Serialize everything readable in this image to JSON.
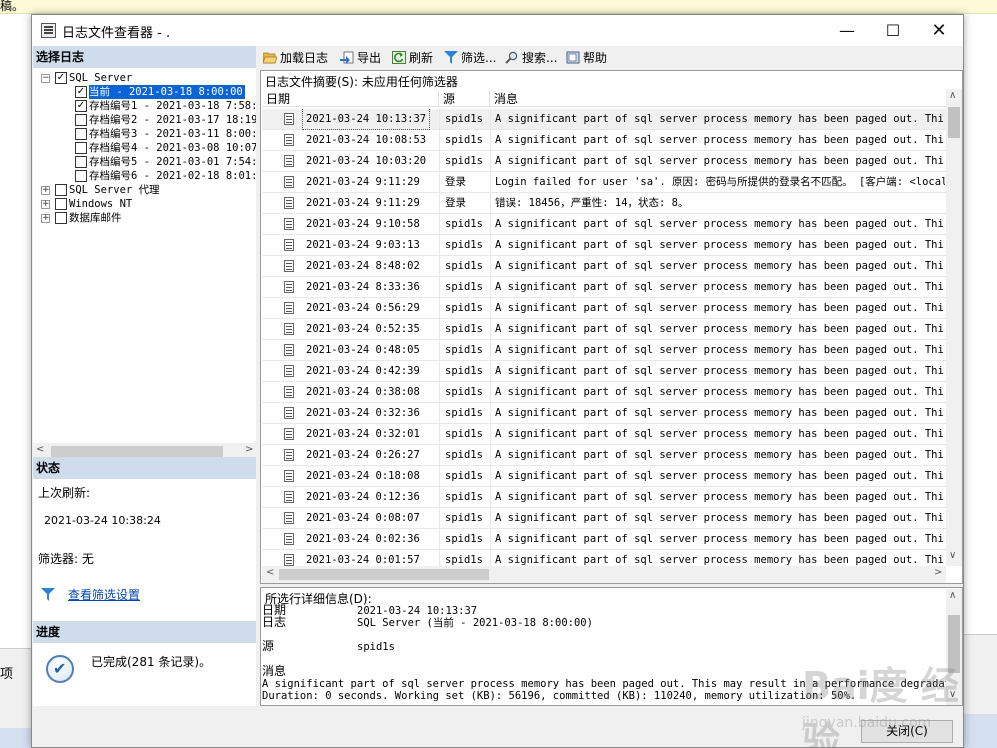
{
  "background": {
    "top_text": "稿。",
    "left_text": "项"
  },
  "window": {
    "title": "日志文件查看器 - .",
    "minimize": "—",
    "maximize": "☐",
    "close": "✕"
  },
  "left": {
    "select_log_header": "选择日志",
    "tree": [
      {
        "label": "SQL Server",
        "checked": true,
        "expander": "−",
        "indent": 0
      },
      {
        "label": "当前 - 2021-03-18 8:00:00",
        "checked": true,
        "selected": true,
        "indent": 1
      },
      {
        "label": "存档编号1 - 2021-03-18 7:58:",
        "checked": true,
        "indent": 1
      },
      {
        "label": "存档编号2 - 2021-03-17 18:19",
        "checked": false,
        "indent": 1
      },
      {
        "label": "存档编号3 - 2021-03-11 8:00:",
        "checked": false,
        "indent": 1
      },
      {
        "label": "存档编号4 - 2021-03-08 10:07",
        "checked": false,
        "indent": 1
      },
      {
        "label": "存档编号5 - 2021-03-01 7:54:",
        "checked": false,
        "indent": 1
      },
      {
        "label": "存档编号6 - 2021-02-18 8:01:",
        "checked": false,
        "indent": 1
      },
      {
        "label": "SQL Server 代理",
        "checked": false,
        "expander": "+",
        "indent": 0
      },
      {
        "label": "Windows NT",
        "checked": false,
        "expander": "+",
        "indent": 0
      },
      {
        "label": "数据库邮件",
        "checked": false,
        "expander": "+",
        "indent": 0
      }
    ],
    "status_header": "状态",
    "last_refresh_label": "上次刷新:",
    "last_refresh_value": "2021-03-24 10:38:24",
    "filter_label": "筛选器: 无",
    "view_filter_link": "查看筛选设置",
    "progress_header": "进度",
    "progress_text": "已完成(281 条记录)。"
  },
  "toolbar": {
    "load_log": "加载日志",
    "export": "导出",
    "refresh": "刷新",
    "filter": "筛选...",
    "search": "搜索...",
    "help": "帮助"
  },
  "log": {
    "summary": "日志文件摘要(S): 未应用任何筛选器",
    "columns": {
      "date": "日期",
      "source": "源",
      "message": "消息"
    },
    "rows": [
      {
        "date": "2021-03-24 10:13:37",
        "source": "spid1s",
        "message": "A significant part of sql server process memory has been paged out. This may"
      },
      {
        "date": "2021-03-24 10:08:53",
        "source": "spid1s",
        "message": "A significant part of sql server process memory has been paged out. This may"
      },
      {
        "date": "2021-03-24 10:03:20",
        "source": "spid1s",
        "message": "A significant part of sql server process memory has been paged out. This may"
      },
      {
        "date": "2021-03-24 9:11:29",
        "source": "登录",
        "message": "Login failed for user 'sa'. 原因: 密码与所提供的登录名不匹配。 [客户端: <local"
      },
      {
        "date": "2021-03-24 9:11:29",
        "source": "登录",
        "message": "错误: 18456，严重性: 14，状态: 8。"
      },
      {
        "date": "2021-03-24 9:10:58",
        "source": "spid1s",
        "message": "A significant part of sql server process memory has been paged out. This may"
      },
      {
        "date": "2021-03-24 9:03:13",
        "source": "spid1s",
        "message": "A significant part of sql server process memory has been paged out. This may"
      },
      {
        "date": "2021-03-24 8:48:02",
        "source": "spid1s",
        "message": "A significant part of sql server process memory has been paged out. This may"
      },
      {
        "date": "2021-03-24 8:33:36",
        "source": "spid1s",
        "message": "A significant part of sql server process memory has been paged out. This may"
      },
      {
        "date": "2021-03-24 0:56:29",
        "source": "spid1s",
        "message": "A significant part of sql server process memory has been paged out. This may"
      },
      {
        "date": "2021-03-24 0:52:35",
        "source": "spid1s",
        "message": "A significant part of sql server process memory has been paged out. This may"
      },
      {
        "date": "2021-03-24 0:48:05",
        "source": "spid1s",
        "message": "A significant part of sql server process memory has been paged out. This may"
      },
      {
        "date": "2021-03-24 0:42:39",
        "source": "spid1s",
        "message": "A significant part of sql server process memory has been paged out. This may"
      },
      {
        "date": "2021-03-24 0:38:08",
        "source": "spid1s",
        "message": "A significant part of sql server process memory has been paged out. This may"
      },
      {
        "date": "2021-03-24 0:32:36",
        "source": "spid1s",
        "message": "A significant part of sql server process memory has been paged out. This may"
      },
      {
        "date": "2021-03-24 0:32:01",
        "source": "spid1s",
        "message": "A significant part of sql server process memory has been paged out. This may"
      },
      {
        "date": "2021-03-24 0:26:27",
        "source": "spid1s",
        "message": "A significant part of sql server process memory has been paged out. This may"
      },
      {
        "date": "2021-03-24 0:18:08",
        "source": "spid1s",
        "message": "A significant part of sql server process memory has been paged out. This may"
      },
      {
        "date": "2021-03-24 0:12:36",
        "source": "spid1s",
        "message": "A significant part of sql server process memory has been paged out. This may"
      },
      {
        "date": "2021-03-24 0:08:07",
        "source": "spid1s",
        "message": "A significant part of sql server process memory has been paged out. This may"
      },
      {
        "date": "2021-03-24 0:02:36",
        "source": "spid1s",
        "message": "A significant part of sql server process memory has been paged out. This may"
      },
      {
        "date": "2021-03-24 0:01:57",
        "source": "spid1s",
        "message": "A significant part of sql server process memory has been paged out. This may"
      }
    ]
  },
  "detail": {
    "title": "所选行详细信息(D):",
    "date_label": "日期",
    "date_value": "2021-03-24 10:13:37",
    "log_label": "日志",
    "log_value": "SQL Server (当前 - 2021-03-18 8:00:00)",
    "source_label": "源",
    "source_value": "spid1s",
    "message_label": "消息",
    "message_line1": "A significant part of sql server process memory has been paged out. This may result in a performance degradation.",
    "message_line2": "Duration: 0 seconds. Working set (KB): 56196, committed (KB): 110240, memory utilization: 50%."
  },
  "buttons": {
    "close": "关闭(C)"
  },
  "watermark": {
    "logo": "Bai度 经验",
    "url": "jingyan.baidu.com"
  }
}
